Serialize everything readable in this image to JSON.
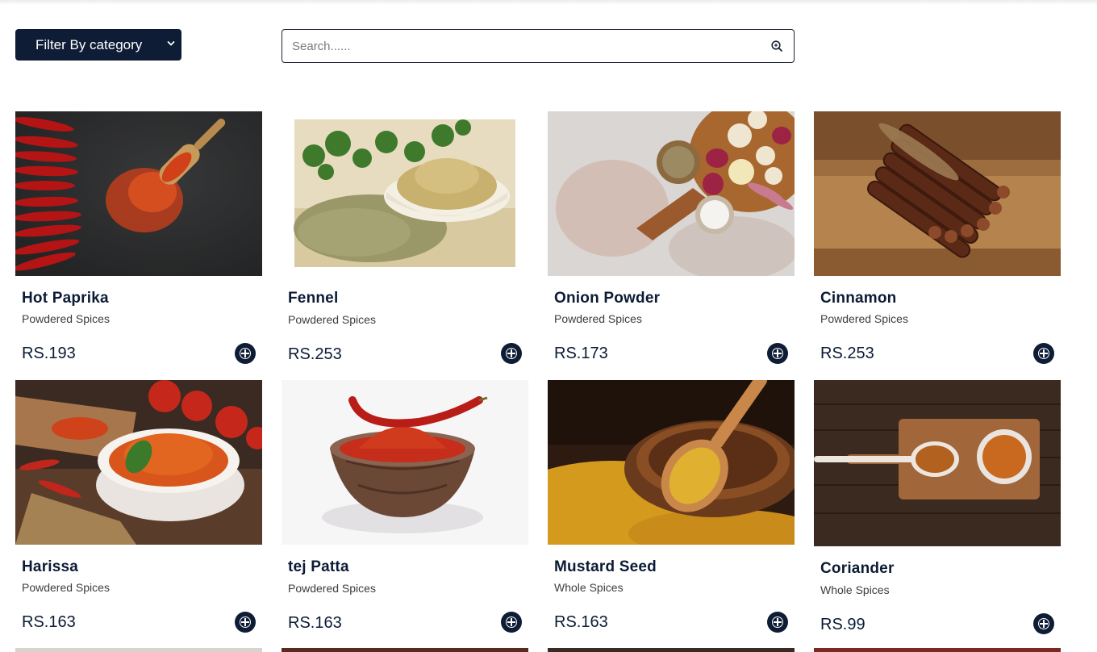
{
  "toolbar": {
    "filter_label": "Filter By category",
    "search_placeholder": "Search......"
  },
  "products": [
    {
      "name": "Hot Paprika",
      "category": "Powdered Spices",
      "price": "RS.193",
      "image": "red chillies and paprika powder in wooden scoop"
    },
    {
      "name": "Fennel",
      "category": "Powdered Spices",
      "price": "RS.253",
      "image": "fennel seeds and powder in bowl"
    },
    {
      "name": "Onion Powder",
      "category": "Powdered Spices",
      "price": "RS.173",
      "image": "onions garlic and spices on board"
    },
    {
      "name": "Cinnamon",
      "category": "Powdered Spices",
      "price": "RS.253",
      "image": "bundle of cinnamon sticks"
    },
    {
      "name": "Harissa",
      "category": "Powdered Spices",
      "price": "RS.163",
      "image": "orange spice powder in white bowl with tomatoes"
    },
    {
      "name": "tej Patta",
      "category": "Powdered Spices",
      "price": "RS.163",
      "image": "red chilli powder in wooden bowl"
    },
    {
      "name": "Mustard Seed",
      "category": "Whole Spices",
      "price": "RS.163",
      "image": "mustard seeds in wooden spoon"
    },
    {
      "name": "Coriander",
      "category": "Whole Spices",
      "price": "RS.99",
      "image": "spice powder on wooden board"
    }
  ]
}
